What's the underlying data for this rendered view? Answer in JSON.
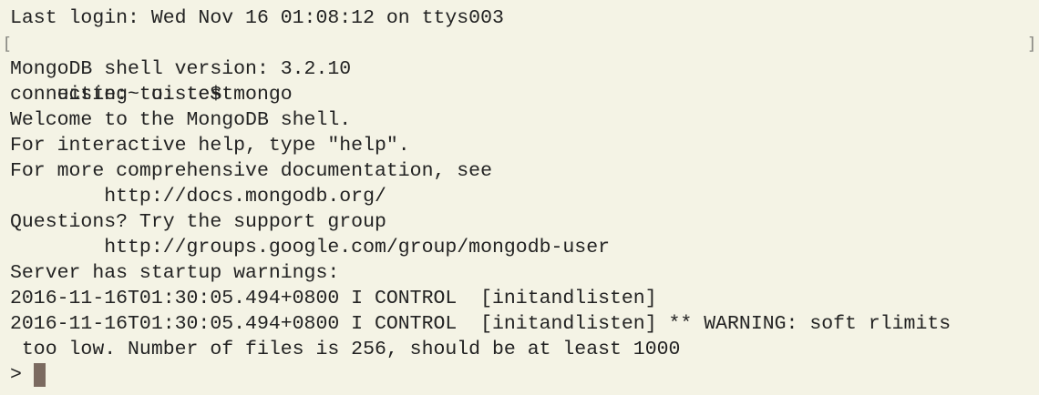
{
  "terminal": {
    "lines": [
      "Last login: Wed Nov 16 01:08:12 on ttys003",
      "uiste:~ uiste$ mongo",
      "MongoDB shell version: 3.2.10",
      "connecting to: test",
      "Welcome to the MongoDB shell.",
      "For interactive help, type \"help\".",
      "For more comprehensive documentation, see",
      "        http://docs.mongodb.org/",
      "Questions? Try the support group",
      "        http://groups.google.com/group/mongodb-user",
      "Server has startup warnings:",
      "2016-11-16T01:30:05.494+0800 I CONTROL  [initandlisten]",
      "2016-11-16T01:30:05.494+0800 I CONTROL  [initandlisten] ** WARNING: soft rlimits",
      " too low. Number of files is 256, should be at least 1000"
    ],
    "prompt": ">",
    "mark_open": "[",
    "mark_close": "]"
  }
}
